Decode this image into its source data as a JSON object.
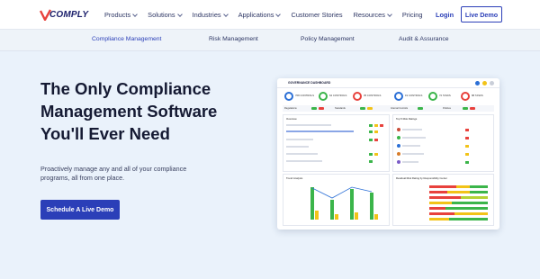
{
  "brand": {
    "logo_text": "COMPLY",
    "logo_mark": "V"
  },
  "nav": {
    "items": [
      {
        "label": "Products",
        "dropdown": true
      },
      {
        "label": "Solutions",
        "dropdown": true
      },
      {
        "label": "Industries",
        "dropdown": true
      },
      {
        "label": "Applications",
        "dropdown": true
      },
      {
        "label": "Customer Stories",
        "dropdown": false
      },
      {
        "label": "Resources",
        "dropdown": true
      },
      {
        "label": "Pricing",
        "dropdown": false
      }
    ],
    "login_label": "Login",
    "demo_label": "Live Demo"
  },
  "subnav": {
    "items": [
      "Compliance Management",
      "Risk Management",
      "Policy Management",
      "Audit & Assurance"
    ],
    "active_index": 0
  },
  "hero": {
    "title_lines": [
      "The Only Compliance",
      "Management Software",
      "You'll Ever Need"
    ],
    "subtitle": "Proactively manage any and all of your compliance programs, all from one place.",
    "cta_label": "Schedule A Live Demo"
  },
  "dashboard": {
    "title": "GOVERNANCE DASHBOARD",
    "kpis": [
      "768 CONTROLS",
      "64 CONTROLS",
      "35 CONTROLS",
      "19 CONTROLS",
      "72 TASKS",
      "88 TASKS"
    ],
    "row_labels": [
      "Regulations",
      "Standards",
      "Internal Controls",
      "Policies"
    ],
    "overview_title": "Overview",
    "analysis_title": "Trend Analysis",
    "top_title": "Top 5 Risk Ratings",
    "risk_title": "Residual Risk Rating by Responsibility Center",
    "colors": {
      "green": "#3bb54a",
      "lime": "#b5d334",
      "yellow": "#f2c318",
      "red": "#e8413c",
      "blue": "#2b6fd6"
    }
  },
  "colors": {
    "accent": "#2b3fb8",
    "background": "#eaf2fb",
    "title": "#151a33"
  }
}
